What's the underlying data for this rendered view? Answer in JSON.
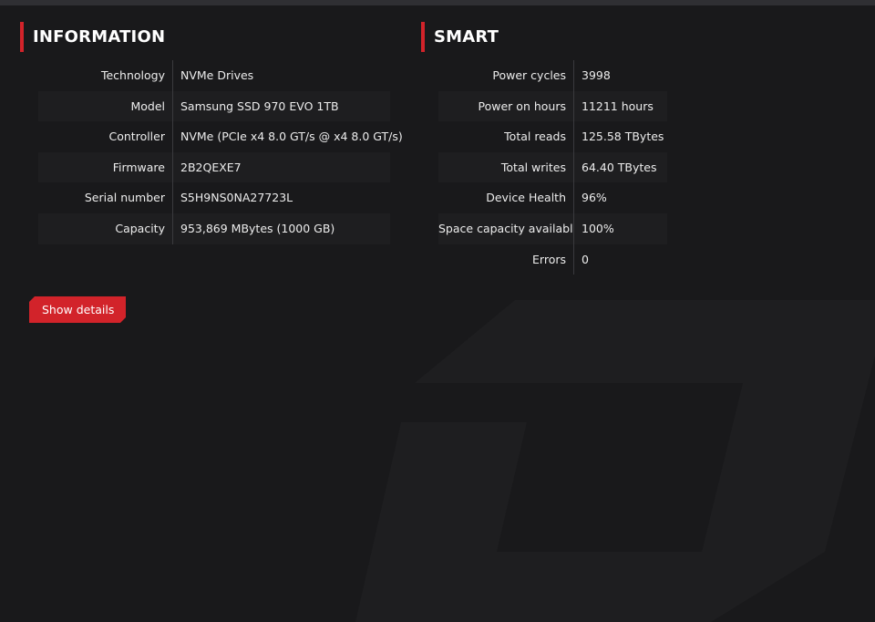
{
  "information": {
    "title": "INFORMATION",
    "rows": [
      {
        "key": "Technology",
        "value": "NVMe Drives"
      },
      {
        "key": "Model",
        "value": "Samsung SSD 970 EVO 1TB"
      },
      {
        "key": "Controller",
        "value": "NVMe (PCIe x4 8.0 GT/s @ x4 8.0 GT/s)"
      },
      {
        "key": "Firmware",
        "value": "2B2QEXE7"
      },
      {
        "key": "Serial number",
        "value": "S5H9NS0NA27723L"
      },
      {
        "key": "Capacity",
        "value": "953,869 MBytes (1000 GB)"
      }
    ]
  },
  "smart": {
    "title": "SMART",
    "rows": [
      {
        "key": "Power cycles",
        "value": "3998"
      },
      {
        "key": "Power on hours",
        "value": "11211 hours"
      },
      {
        "key": "Total reads",
        "value": "125.58 TBytes"
      },
      {
        "key": "Total writes",
        "value": "64.40 TBytes"
      },
      {
        "key": "Device Health",
        "value": "96%"
      },
      {
        "key": "Space capacity availabl",
        "value": "100%"
      },
      {
        "key": "Errors",
        "value": "0"
      }
    ]
  },
  "actions": {
    "show_details_label": "Show details"
  },
  "colors": {
    "accent": "#d2232a",
    "background": "#19191b",
    "row_alt": "#1e1e20"
  }
}
